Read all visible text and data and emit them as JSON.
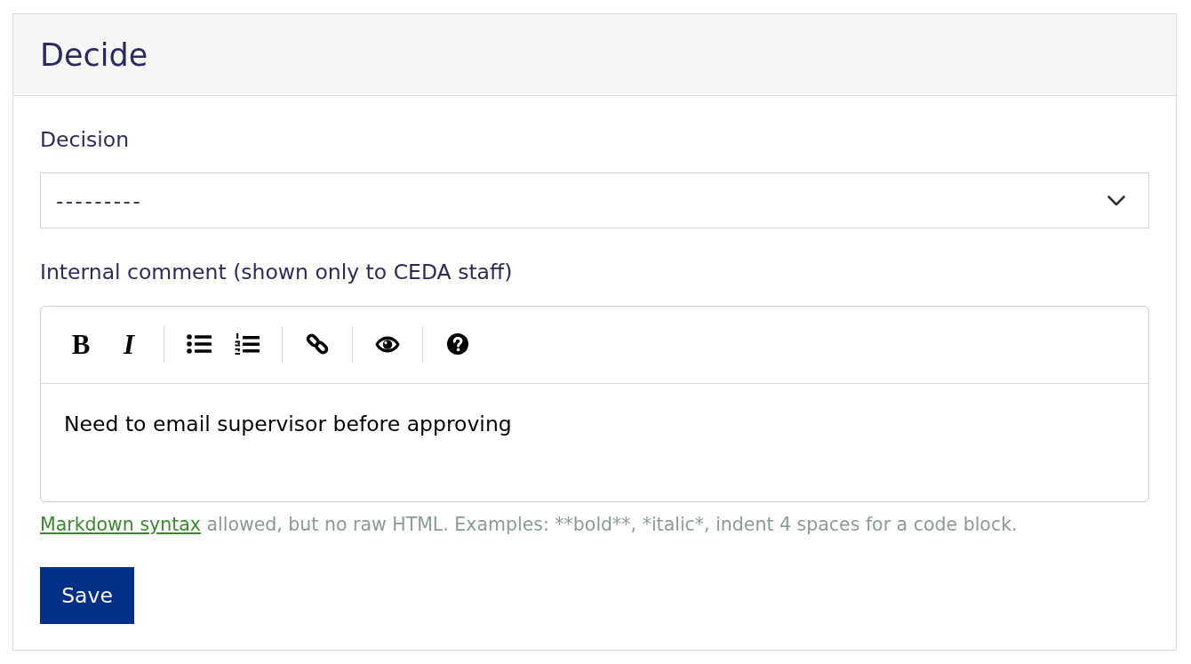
{
  "card": {
    "title": "Decide"
  },
  "decision": {
    "label": "Decision",
    "value": "---------"
  },
  "comment": {
    "label": "Internal comment (shown only to CEDA staff)",
    "toolbar": {
      "groups": [
        {
          "buttons": [
            {
              "kind": "bold",
              "text": "B"
            },
            {
              "kind": "italic",
              "text": "I"
            }
          ]
        },
        {
          "buttons": [
            {
              "kind": "bullet_list"
            },
            {
              "kind": "numbered_list"
            }
          ]
        },
        {
          "buttons": [
            {
              "kind": "link"
            }
          ]
        },
        {
          "buttons": [
            {
              "kind": "preview"
            }
          ]
        },
        {
          "buttons": [
            {
              "kind": "help"
            }
          ]
        }
      ]
    },
    "value": "Need to email supervisor before approving"
  },
  "help": {
    "link": "Markdown syntax",
    "text": "allowed, but no raw HTML. Examples: **bold**, *italic*, indent 4 spaces for a code block."
  },
  "save_button": {
    "label": "Save"
  }
}
